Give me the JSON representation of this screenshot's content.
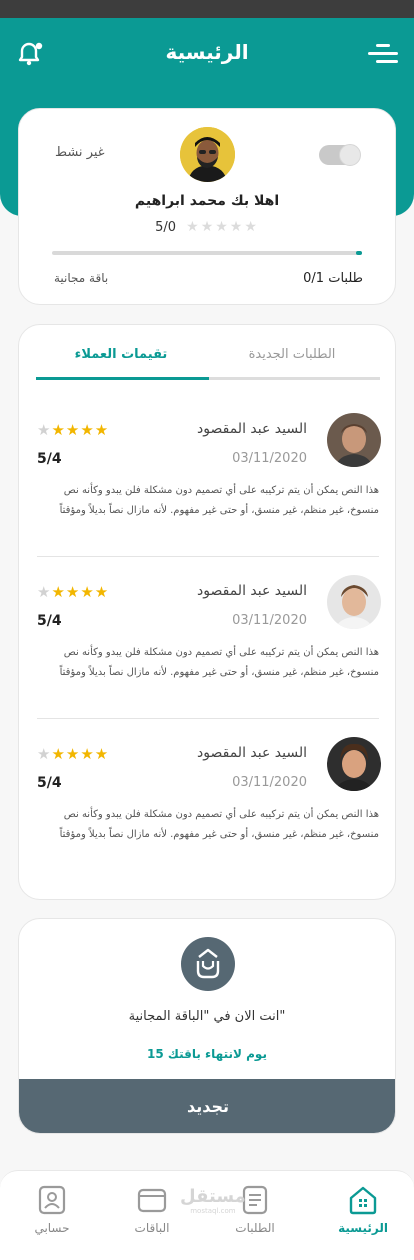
{
  "header": {
    "title": "الرئيسية",
    "bell_icon": "bell-icon",
    "menu_icon": "menu-icon"
  },
  "profile": {
    "status": "غير نشط",
    "greeting": "اهلا بك محمد ابراهيم",
    "rating_text": "5/0",
    "stars": "★★★★★",
    "orders": "0/1 طلبات",
    "package": "باقة مجانية",
    "progress_fraction": 0.02
  },
  "tabs": {
    "ratings": "تقيمات العملاء",
    "new_orders": "الطلبات الجديدة"
  },
  "reviews": [
    {
      "name": "السيد عبد المقصود",
      "date": "03/11/2020",
      "score": "5/4",
      "stars_on": "★★★★",
      "stars_off": "★",
      "text": "هذا النص يمكن أن يتم تركيبه على أي تصميم دون مشكلة فلن يبدو وكأنه نص منسوخ، غير منظم، غير منسق، أو حتى غير مفهوم. لأنه مازال نصاً بديلاً ومؤقتاً"
    },
    {
      "name": "السيد عبد المقصود",
      "date": "03/11/2020",
      "score": "5/4",
      "stars_on": "★★★★",
      "stars_off": "★",
      "text": "هذا النص يمكن أن يتم تركيبه على أي تصميم دون مشكلة فلن يبدو وكأنه نص منسوخ، غير منظم، غير منسق، أو حتى غير مفهوم. لأنه مازال نصاً بديلاً ومؤقتاً"
    },
    {
      "name": "السيد عبد المقصود",
      "date": "03/11/2020",
      "score": "5/4",
      "stars_on": "★★★★",
      "stars_off": "★",
      "text": "هذا النص يمكن أن يتم تركيبه على أي تصميم دون مشكلة فلن يبدو وكأنه نص منسوخ، غير منظم، غير منسق، أو حتى غير مفهوم. لأنه مازال نصاً بديلاً ومؤقتاً"
    }
  ],
  "package_card": {
    "line": "انت الان في \"الباقة المجانية\"",
    "days": "15 يوم لانتهاء باقتك",
    "renew": "تجديد"
  },
  "nav": {
    "home": "الرئيسية",
    "orders": "الطلبات",
    "packages": "الباقات",
    "account": "حسابي"
  },
  "watermark": {
    "main": "مستقل",
    "sub": "mostaql.com"
  },
  "colors": {
    "primary": "#0b9a94",
    "dark": "#566873",
    "star": "#f2b600"
  }
}
